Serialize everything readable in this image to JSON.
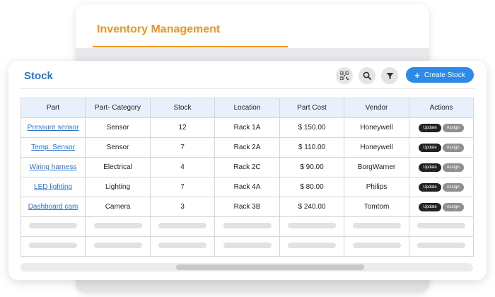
{
  "back_panel": {
    "title": "Inventory Management"
  },
  "stock_panel": {
    "title": "Stock",
    "toolbar": {
      "qr_icon": "qr-code-icon",
      "search_icon": "search-icon",
      "filter_icon": "filter-icon",
      "create_plus": "+",
      "create_label": "Create Stock"
    },
    "table": {
      "columns": [
        "Part",
        "Part- Category",
        "Stock",
        "Location",
        "Part Cost",
        "Vendor",
        "Actions"
      ],
      "rows": [
        {
          "part": "Pressure sensor",
          "category": "Sensor",
          "stock": "12",
          "location": "Rack 1A",
          "cost": "$ 150.00",
          "vendor": "Honeywell",
          "update": "Update",
          "assign": "Assign"
        },
        {
          "part": "Temp. Sensor",
          "category": "Sensor",
          "stock": "7",
          "location": "Rack 2A",
          "cost": "$ 110.00",
          "vendor": "Honeywell",
          "update": "Update",
          "assign": "Assign"
        },
        {
          "part": "Wiring harness",
          "category": "Electrical",
          "stock": "4",
          "location": "Rack 2C",
          "cost": "$ 90.00",
          "vendor": "BorgWarner",
          "update": "Update",
          "assign": "Assign"
        },
        {
          "part": "LED lighting",
          "category": "Lighting",
          "stock": "7",
          "location": "Rack 4A",
          "cost": "$ 80.00",
          "vendor": "Philips",
          "update": "Update",
          "assign": "Assign"
        },
        {
          "part": "Dashboard cam",
          "category": "Camera",
          "stock": "3",
          "location": "Rack 3B",
          "cost": "$ 240.00",
          "vendor": "Tomtom",
          "update": "Update",
          "assign": "Assign"
        }
      ]
    }
  }
}
